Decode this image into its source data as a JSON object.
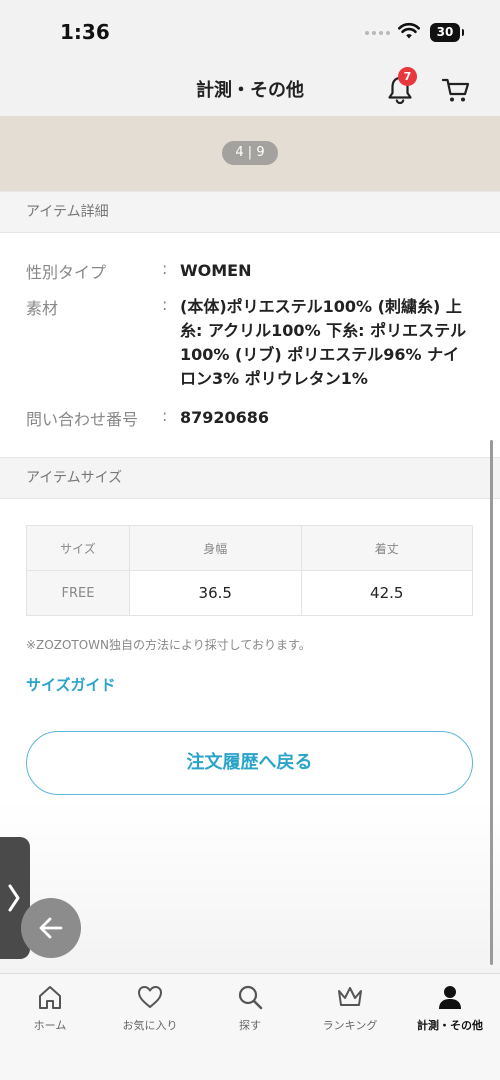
{
  "status_bar": {
    "time": "1:36",
    "battery": "30"
  },
  "header": {
    "title": "計測・その他",
    "notification_count": "7"
  },
  "gallery": {
    "counter": "4 | 9"
  },
  "item_details": {
    "section_title": "アイテム詳細",
    "rows": [
      {
        "label": "性別タイプ",
        "value": "WOMEN"
      },
      {
        "label": "素材",
        "value": "(本体)ポリエステル100% (刺繍糸) 上糸: アクリル100% 下糸: ポリエステル100% (リブ) ポリエステル96% ナイロン3% ポリウレタン1%"
      },
      {
        "label": "問い合わせ番号",
        "value": "87920686"
      }
    ]
  },
  "item_size": {
    "section_title": "アイテムサイズ",
    "columns": [
      "サイズ",
      "身幅",
      "着丈"
    ],
    "rows": [
      {
        "size": "FREE",
        "width": "36.5",
        "length": "42.5"
      }
    ],
    "note": "※ZOZOTOWN独自の方法により採寸しております。",
    "guide_link": "サイズガイド"
  },
  "actions": {
    "back_to_orders": "注文履歴へ戻る"
  },
  "tab_bar": {
    "items": [
      {
        "label": "ホーム",
        "icon": "home-icon"
      },
      {
        "label": "お気に入り",
        "icon": "heart-icon"
      },
      {
        "label": "探す",
        "icon": "search-icon"
      },
      {
        "label": "ランキング",
        "icon": "crown-icon"
      },
      {
        "label": "計測・その他",
        "icon": "person-icon",
        "active": true
      }
    ]
  },
  "colors": {
    "accent": "#2ba4c9",
    "badge": "#e8383d"
  }
}
